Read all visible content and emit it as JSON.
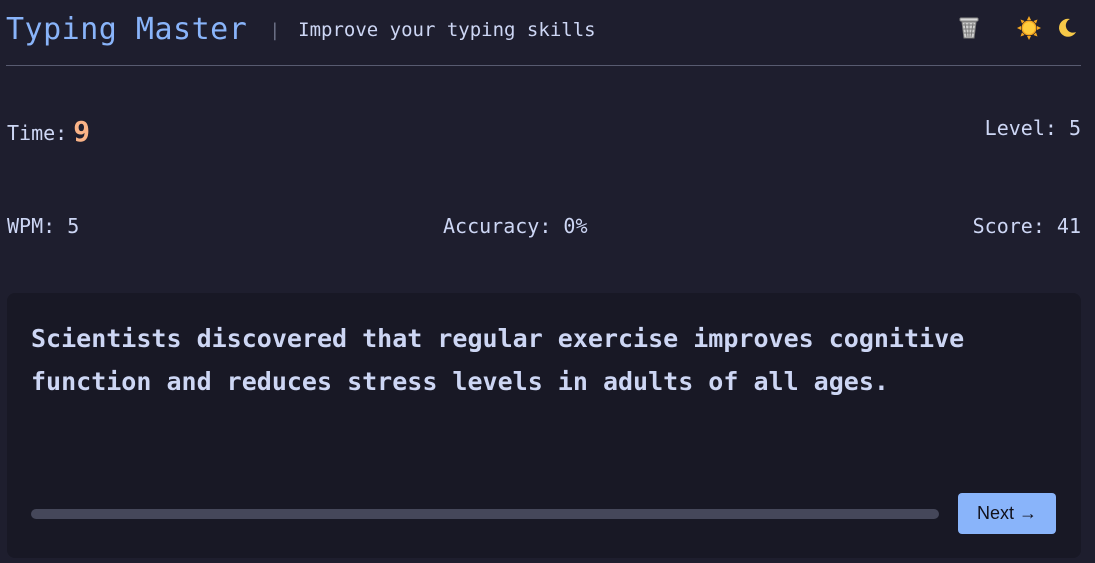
{
  "header": {
    "title": "Typing Master",
    "separator": "|",
    "subtitle": "Improve your typing skills",
    "icons": {
      "trash": "trash-icon",
      "light_theme": "sun-icon",
      "dark_theme": "moon-icon"
    }
  },
  "stats": {
    "time_label": "Time:",
    "time_value": "9",
    "level_label": "Level:",
    "level_value": "5",
    "wpm_label": "WPM:",
    "wpm_value": "5",
    "accuracy_label": "Accuracy:",
    "accuracy_value": "0%",
    "score_label": "Score:",
    "score_value": "41"
  },
  "typing": {
    "prompt": "Scientists discovered that regular exercise improves cognitive function and reduces stress levels in adults of all ages.",
    "progress_fraction": 0,
    "next_label": "Next →"
  },
  "colors": {
    "background": "#1e1e2e",
    "card": "#181825",
    "accent": "#89b4fa",
    "time_highlight": "#fab387",
    "progress_track": "#45475a"
  }
}
